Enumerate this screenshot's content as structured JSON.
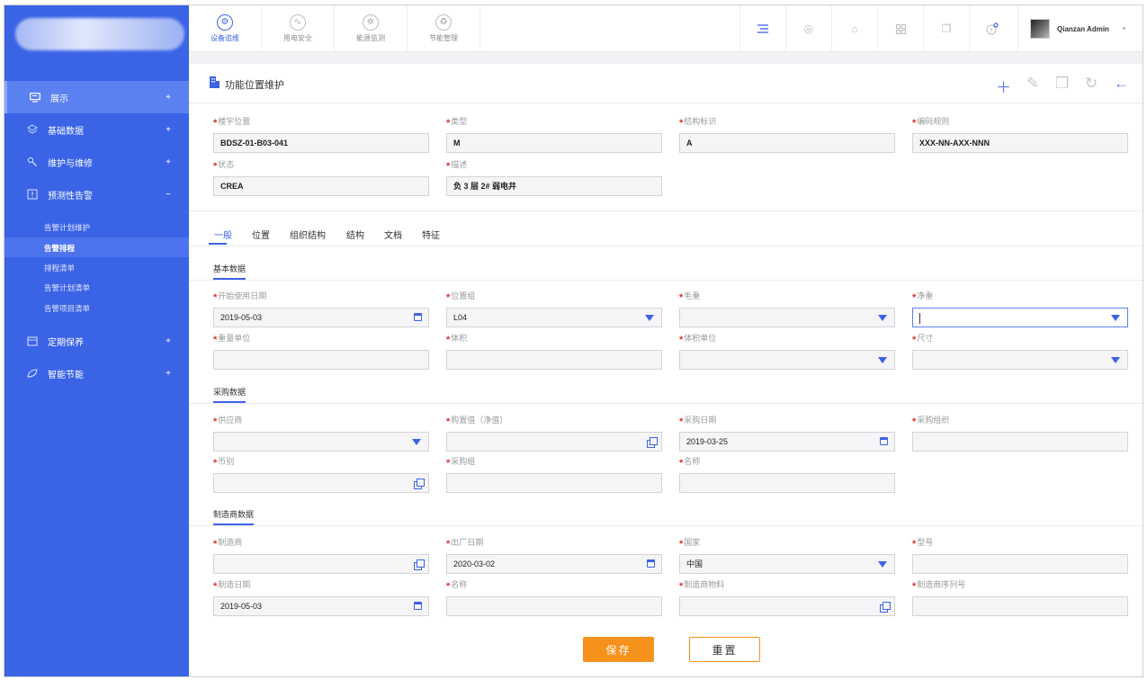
{
  "topnav": {
    "tabs": [
      {
        "label": "设备追维",
        "icon": "gear-icon"
      },
      {
        "label": "用电安全",
        "icon": "pulse-icon"
      },
      {
        "label": "能源监测",
        "icon": "atom-icon"
      },
      {
        "label": "节能管理",
        "icon": "recycle-icon"
      }
    ],
    "user": "Qianzan Admin"
  },
  "sidebar": {
    "items": [
      {
        "label": "展示",
        "icon": "display-icon",
        "toggle": "+"
      },
      {
        "label": "基础数据",
        "icon": "layers-icon",
        "toggle": "+"
      },
      {
        "label": "维护与维修",
        "icon": "wrench-icon",
        "toggle": "+"
      },
      {
        "label": "预测性告警",
        "icon": "alert-icon",
        "toggle": "−"
      },
      {
        "label": "定期保养",
        "icon": "calendar-icon",
        "toggle": "+"
      },
      {
        "label": "智能节能",
        "icon": "leaf-icon",
        "toggle": "+"
      }
    ],
    "subitems": [
      "告警计划维护",
      "告警排程",
      "排程清单",
      "告警计划清单",
      "告警项目清单"
    ]
  },
  "page": {
    "title": "功能位置维护"
  },
  "header_fields": [
    {
      "label": "楼宇位置",
      "value": "BDSZ-01-B03-041"
    },
    {
      "label": "类型",
      "value": "M"
    },
    {
      "label": "结构标识",
      "value": "A"
    },
    {
      "label": "编码规则",
      "value": "XXX-NN-AXX-NNN"
    },
    {
      "label": "状态",
      "value": "CREA"
    },
    {
      "label": "描述",
      "value": "负 3 层 2# 弱电井"
    }
  ],
  "tabs": [
    "一般",
    "位置",
    "组织结构",
    "结构",
    "文档",
    "特征"
  ],
  "sections": {
    "basic": {
      "title": "基本数据",
      "fields": [
        {
          "label": "开始使用日期",
          "value": "2019-05-03"
        },
        {
          "label": "位置组",
          "value": "L04"
        },
        {
          "label": "毛重",
          "value": ""
        },
        {
          "label": "净重",
          "value": ""
        },
        {
          "label": "重量单位",
          "value": ""
        },
        {
          "label": "体积",
          "value": ""
        },
        {
          "label": "体积单位",
          "value": ""
        },
        {
          "label": "尺寸",
          "value": ""
        }
      ]
    },
    "purchase": {
      "title": "采购数据",
      "fields": [
        {
          "label": "供应商",
          "value": ""
        },
        {
          "label": "购置值（净值）",
          "value": ""
        },
        {
          "label": "采购日期",
          "value": "2019-03-25"
        },
        {
          "label": "采购组织",
          "value": ""
        },
        {
          "label": "币别",
          "value": ""
        },
        {
          "label": "采购组",
          "value": ""
        },
        {
          "label": "名称",
          "value": ""
        }
      ]
    },
    "maker": {
      "title": "制造商数据",
      "fields": [
        {
          "label": "制造商",
          "value": ""
        },
        {
          "label": "出厂日期",
          "value": "2020-03-02"
        },
        {
          "label": "国家",
          "value": "中国"
        },
        {
          "label": "型号",
          "value": ""
        },
        {
          "label": "制造日期",
          "value": "2019-05-03"
        },
        {
          "label": "名称",
          "value": ""
        },
        {
          "label": "制造商物料",
          "value": ""
        },
        {
          "label": "制造商序列号",
          "value": ""
        }
      ]
    }
  },
  "buttons": {
    "save": "保存",
    "reset": "重置"
  }
}
